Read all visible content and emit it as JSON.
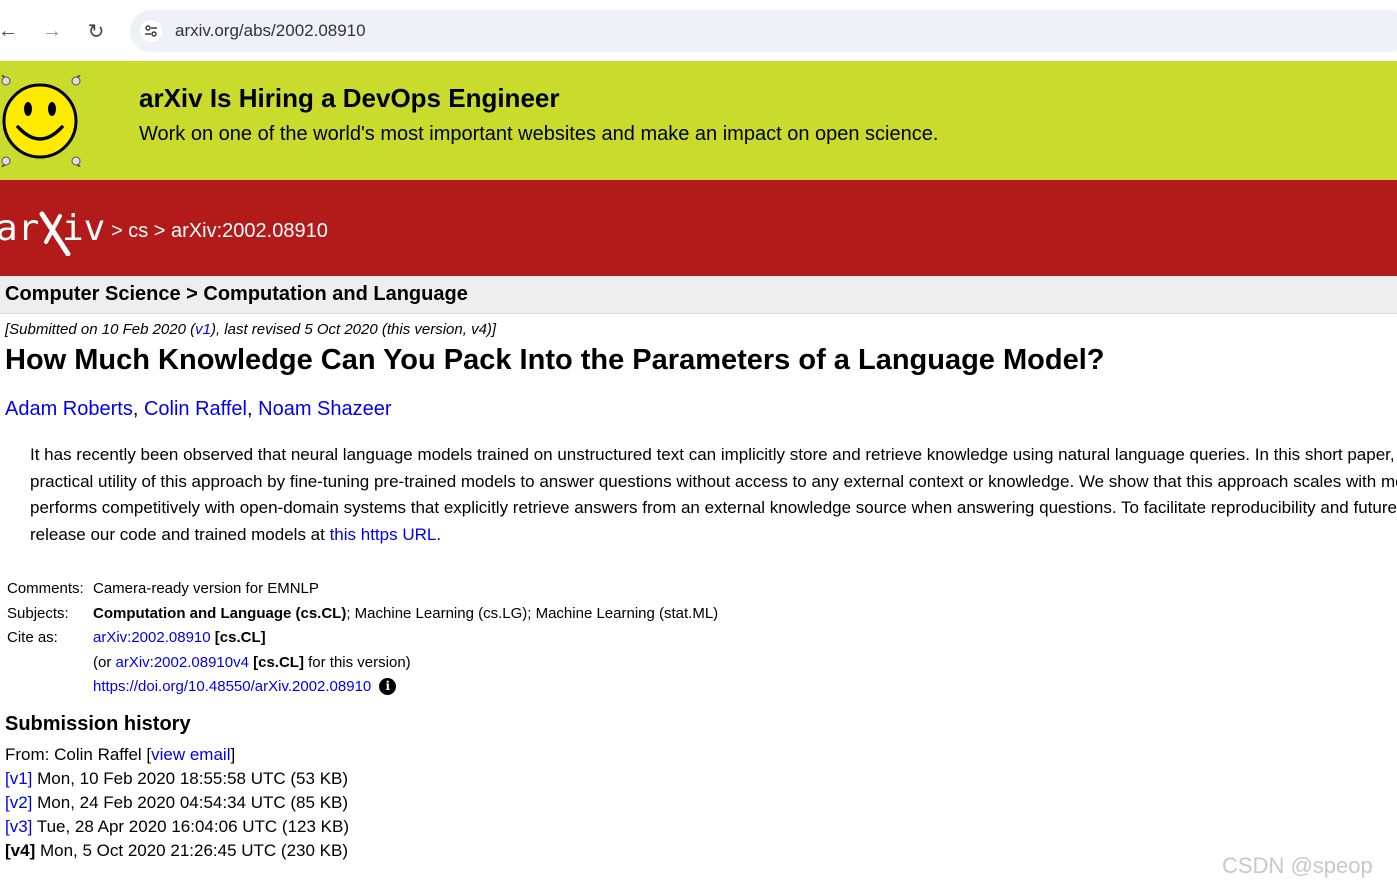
{
  "browser": {
    "back_icon": "←",
    "forward_icon": "→",
    "reload_icon": "↻",
    "url": "arxiv.org/abs/2002.08910"
  },
  "banner": {
    "title": "arXiv Is Hiring a DevOps Engineer",
    "subtitle": "Work on one of the world's most important websites and make an impact on open science.",
    "bg_color": "#c9dc2e"
  },
  "header": {
    "brand_color": "#b31b1b",
    "sep1": " > ",
    "crumb_cs": "cs",
    "sep2": " > ",
    "crumb_id": "arXiv:2002.08910"
  },
  "subheader": {
    "text": "Computer Science > Computation and Language"
  },
  "dateline": {
    "prefix": "[Submitted on 10 Feb 2020 (",
    "v1": "v1",
    "suffix": "), last revised 5 Oct 2020 (this version, v4)]"
  },
  "paper": {
    "title": "How Much Knowledge Can You Pack Into the Parameters of a Language Model?",
    "authors": [
      "Adam Roberts",
      "Colin Raffel",
      "Noam Shazeer"
    ],
    "author_sep": ", ",
    "abstract_lines": [
      "It has recently been observed that neural language models trained on unstructured text can implicitly store and retrieve knowledge using natural language queries. In this short paper, w",
      "practical utility of this approach by fine-tuning pre-trained models to answer questions without access to any external context or knowledge. We show that this approach scales with moc",
      "performs competitively with open-domain systems that explicitly retrieve answers from an external knowledge source when answering questions. To facilitate reproducibility and future w"
    ],
    "abstract_last_prefix": "release our code and trained models at ",
    "abstract_link": "this https URL",
    "abstract_last_suffix": "."
  },
  "meta": {
    "comments_label": "Comments:",
    "comments_value": "Camera-ready version for EMNLP",
    "subjects_label": "Subjects:",
    "subjects_primary": "Computation and Language (cs.CL)",
    "subjects_rest": "; Machine Learning (cs.LG); Machine Learning (stat.ML)",
    "cite_label": "Cite as:",
    "cite_link": "arXiv:2002.08910",
    "cite_cat": "[cs.CL]",
    "cite2_prefix": "(or ",
    "cite2_link": "arXiv:2002.08910v4",
    "cite2_cat": "[cs.CL]",
    "cite2_suffix": " for this version)",
    "doi": "https://doi.org/10.48550/arXiv.2002.08910",
    "info_glyph": "i"
  },
  "history": {
    "title": "Submission history",
    "from_prefix": "From: Colin Raffel [",
    "view_email": "view email",
    "from_suffix": "]",
    "versions": [
      {
        "tag": "[v1]",
        "text": " Mon, 10 Feb 2020 18:55:58 UTC (53 KB)"
      },
      {
        "tag": "[v2]",
        "text": " Mon, 24 Feb 2020 04:54:34 UTC (85 KB)"
      },
      {
        "tag": "[v3]",
        "text": " Tue, 28 Apr 2020 16:04:06 UTC (123 KB)"
      },
      {
        "tag": "[v4]",
        "text": " Mon, 5 Oct 2020 21:26:45 UTC (230 KB)"
      }
    ]
  },
  "watermark": "CSDN @speop"
}
